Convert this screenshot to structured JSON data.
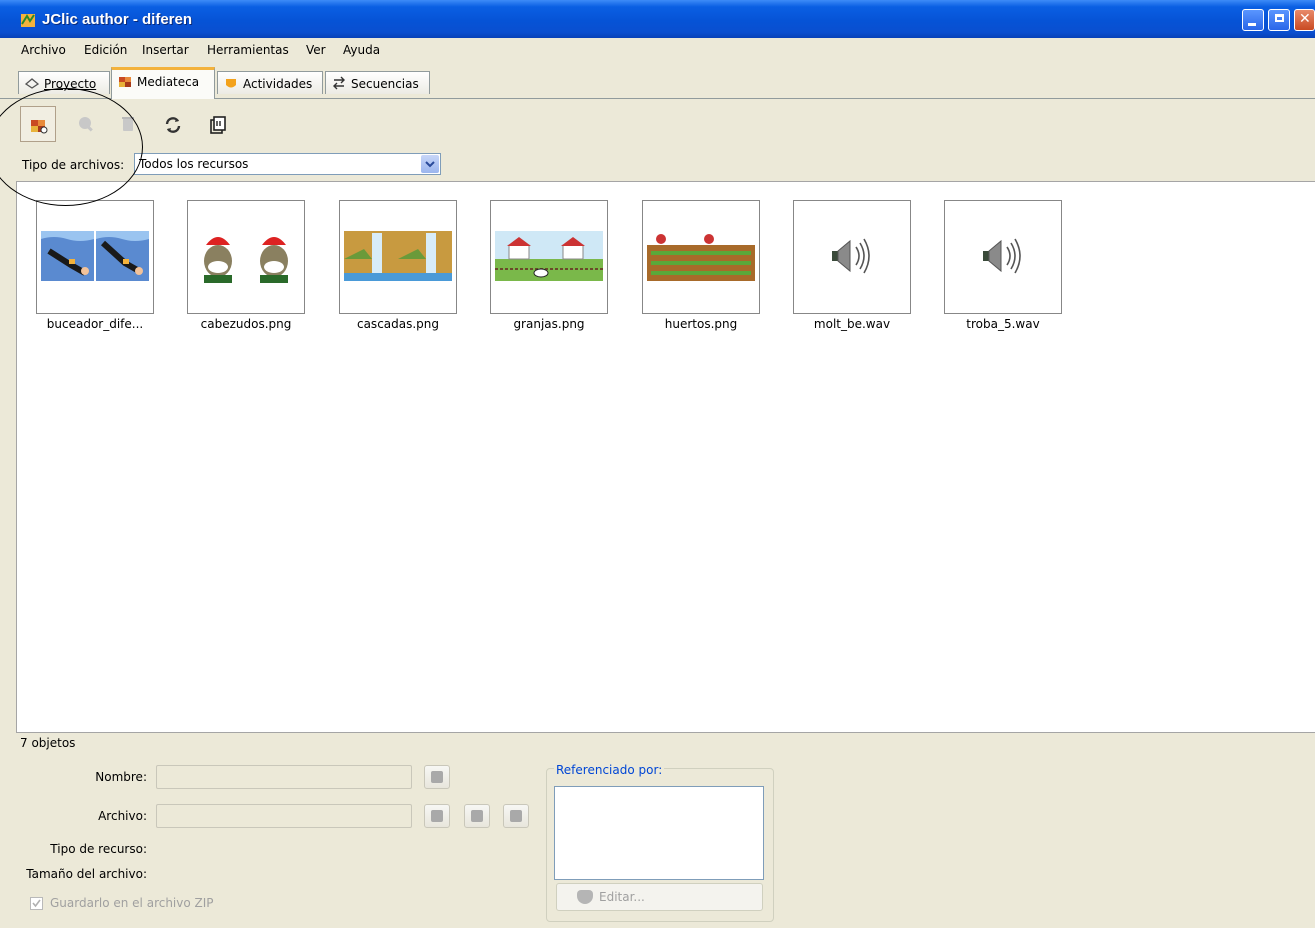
{
  "window": {
    "title": "JClic author - diferen"
  },
  "menu": [
    "Archivo",
    "Edición",
    "Insertar",
    "Herramientas",
    "Ver",
    "Ayuda"
  ],
  "tabs": [
    {
      "label": "Proyecto",
      "icon": "project-icon",
      "active": false
    },
    {
      "label": "Mediateca",
      "icon": "media-library-icon",
      "active": true
    },
    {
      "label": "Actividades",
      "icon": "activities-icon",
      "active": false
    },
    {
      "label": "Secuencias",
      "icon": "sequences-icon",
      "active": false
    }
  ],
  "toolbar": [
    {
      "name": "add-media-button",
      "icon": "add-media-icon",
      "enabled": true,
      "selected": true
    },
    {
      "name": "preview-button",
      "icon": "magnifier-icon",
      "enabled": false
    },
    {
      "name": "delete-button",
      "icon": "trash-icon",
      "enabled": false
    },
    {
      "name": "update-button",
      "icon": "refresh-icon",
      "enabled": true
    },
    {
      "name": "export-button",
      "icon": "export-icon",
      "enabled": true
    }
  ],
  "filter": {
    "label": "Tipo de archivos:",
    "value": "Todos los recursos"
  },
  "items": [
    {
      "caption": "buceador_dife...",
      "kind": "image",
      "art": "diver"
    },
    {
      "caption": "cabezudos.png",
      "kind": "image",
      "art": "bighead"
    },
    {
      "caption": "cascadas.png",
      "kind": "image",
      "art": "waterfall"
    },
    {
      "caption": "granjas.png",
      "kind": "image",
      "art": "farm"
    },
    {
      "caption": "huertos.png",
      "kind": "image",
      "art": "garden"
    },
    {
      "caption": "molt_be.wav",
      "kind": "audio",
      "art": "speaker"
    },
    {
      "caption": "troba_5.wav",
      "kind": "audio",
      "art": "speaker"
    }
  ],
  "status": {
    "count": "7 objetos"
  },
  "details": {
    "name_label": "Nombre:",
    "file_label": "Archivo:",
    "type_label": "Tipo de recurso:",
    "size_label": "Tamaño del archivo:",
    "zip_label": "Guardarlo en el archivo ZIP",
    "zip_checked": true
  },
  "references": {
    "legend": "Referenciado por:",
    "edit_label": "Editar..."
  },
  "colors": {
    "titlebar": "#0653d6",
    "panel": "#ece9d8",
    "tab_highlight": "#f3b23c",
    "legend": "#0046d5"
  }
}
